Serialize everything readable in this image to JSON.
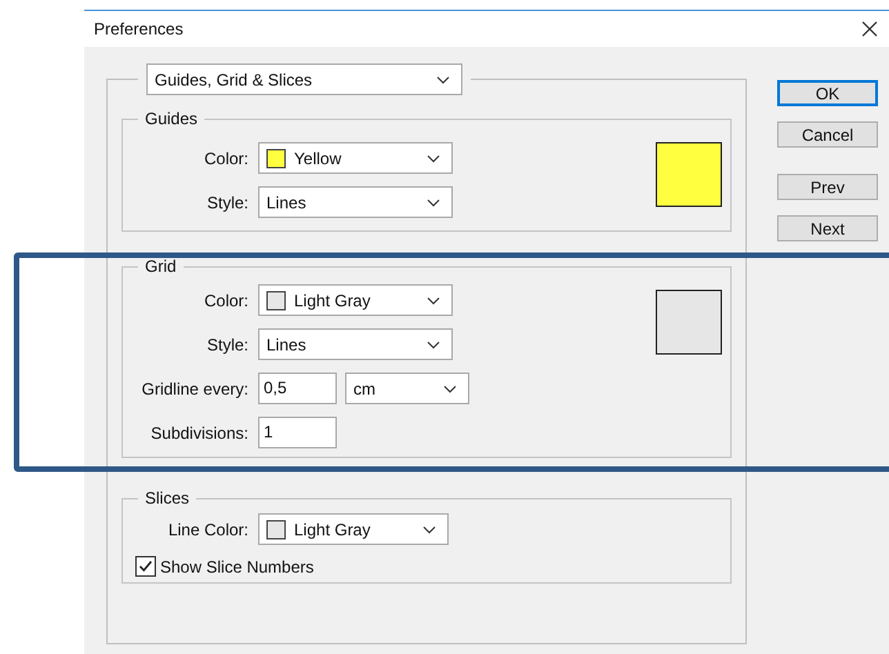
{
  "window": {
    "title": "Preferences"
  },
  "category": "Guides, Grid & Slices",
  "sections": [
    {
      "title": "Guides",
      "highlighted": false,
      "preview": true,
      "rows": [
        {
          "kind": "select",
          "label": "Color:",
          "value": "Yellow",
          "color": "#ffff40"
        },
        {
          "kind": "select",
          "label": "Style:",
          "value": "Lines"
        }
      ]
    },
    {
      "title": "Grid",
      "highlighted": true,
      "preview": true,
      "rows": [
        {
          "kind": "select",
          "label": "Color:",
          "value": "Light Gray",
          "color": "#e6e6e6"
        },
        {
          "kind": "select",
          "label": "Style:",
          "value": "Lines"
        },
        {
          "kind": "number_unit",
          "label": "Gridline every:",
          "value": "0,5",
          "unit": "cm"
        },
        {
          "kind": "input",
          "label": "Subdivisions:",
          "value": "1"
        }
      ]
    },
    {
      "title": "Slices",
      "highlighted": false,
      "preview": false,
      "rows": [
        {
          "kind": "select",
          "label": "Line Color:",
          "value": "Light Gray",
          "color": "#e6e6e6"
        },
        {
          "kind": "checkbox",
          "label": "Show Slice Numbers",
          "checked": true
        }
      ]
    }
  ],
  "buttons": [
    {
      "label": "OK",
      "default": true
    },
    {
      "label": "Cancel",
      "default": false
    },
    {
      "label": "Prev",
      "default": false
    },
    {
      "label": "Next",
      "default": false
    }
  ]
}
